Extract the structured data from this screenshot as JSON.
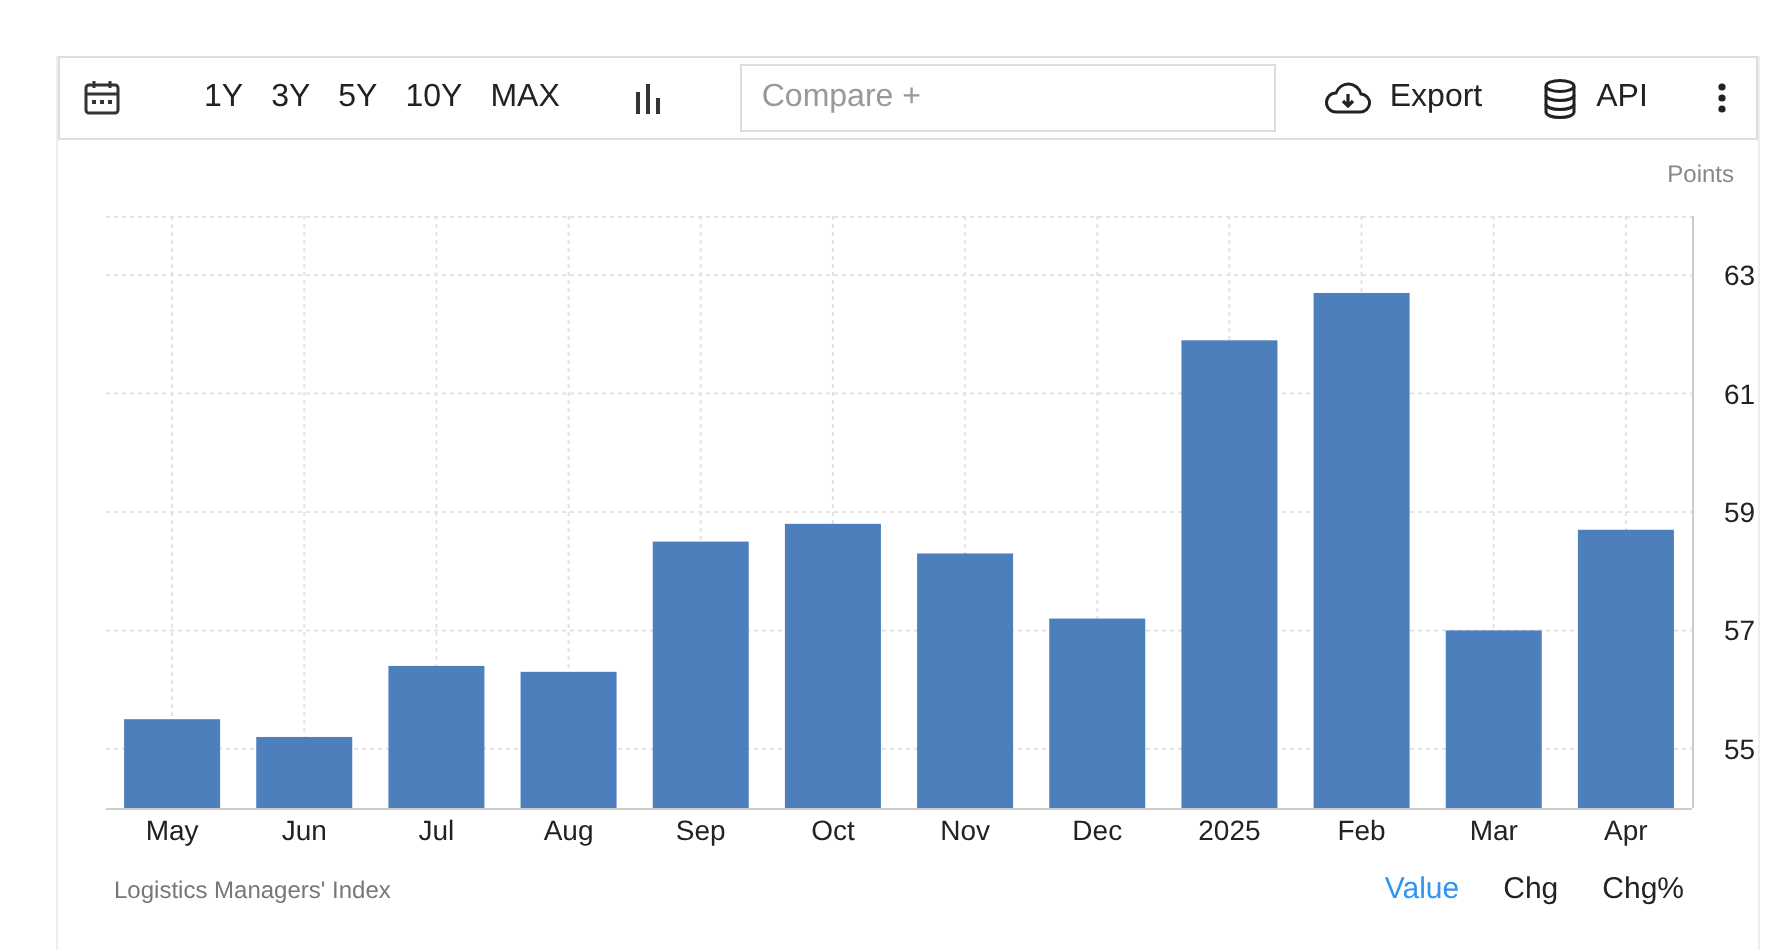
{
  "toolbar": {
    "ranges": [
      "1Y",
      "3Y",
      "5Y",
      "10Y",
      "MAX"
    ],
    "compare": {
      "placeholder": "Compare +"
    },
    "actions": [
      {
        "kind": "export",
        "label": "Export"
      },
      {
        "kind": "api",
        "label": "API"
      }
    ]
  },
  "chart": {
    "unit": "Points",
    "chart_data": {
      "type": "bar",
      "categories": [
        "May",
        "Jun",
        "Jul",
        "Aug",
        "Sep",
        "Oct",
        "Nov",
        "Dec",
        "2025",
        "Feb",
        "Mar",
        "Apr"
      ],
      "series": [
        {
          "name": "Logistics Managers' Index",
          "color": "#4d7fbd",
          "values": [
            55.5,
            55.2,
            56.4,
            56.3,
            58.5,
            58.8,
            58.3,
            57.2,
            61.9,
            62.7,
            57.0,
            58.7
          ]
        }
      ],
      "ylim": [
        54,
        64
      ],
      "yticks": [
        55,
        57,
        59,
        61,
        63
      ],
      "grid": true
    }
  },
  "footer": {
    "views": [
      {
        "label": "Value",
        "selected": true
      },
      {
        "label": "Chg",
        "selected": false
      },
      {
        "label": "Chg%",
        "selected": false
      }
    ]
  }
}
